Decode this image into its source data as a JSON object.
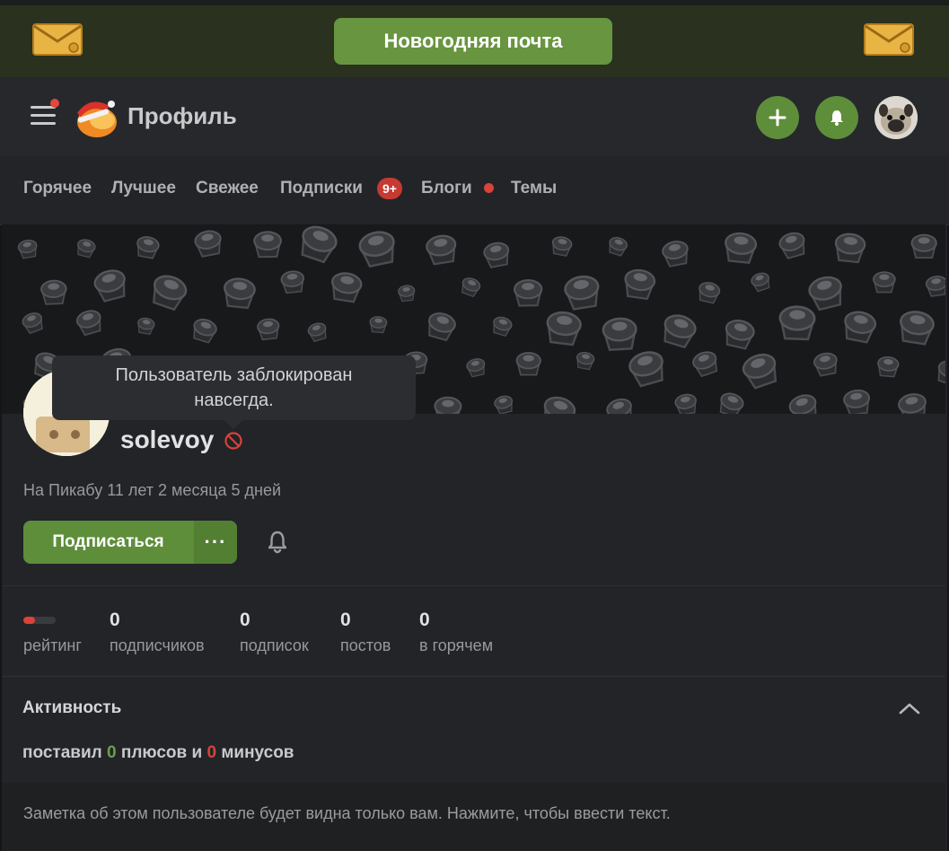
{
  "promo": {
    "label": "Новогодняя почта"
  },
  "header": {
    "title": "Профиль"
  },
  "tabs": [
    {
      "label": "Горячее"
    },
    {
      "label": "Лучшее"
    },
    {
      "label": "Свежее"
    },
    {
      "label": "Подписки"
    },
    {
      "label": "Блоги"
    },
    {
      "label": "Темы"
    }
  ],
  "subscriptions_badge": "9+",
  "profile": {
    "tooltip_line1": "Пользователь заблокирован",
    "tooltip_line2": "навсегда.",
    "username": "solevoy",
    "since": "На Пикабу 11 лет 2 месяца 5 дней",
    "subscribe_label": "Подписаться",
    "more_label": "···"
  },
  "stats": {
    "rating_label": "рейтинг",
    "items": [
      {
        "value": "0",
        "label": "подписчиков"
      },
      {
        "value": "0",
        "label": "подписок"
      },
      {
        "value": "0",
        "label": "постов"
      },
      {
        "value": "0",
        "label": "в горячем"
      }
    ]
  },
  "activity": {
    "title": "Активность",
    "prefix": "поставил",
    "plus_count": "0",
    "middle": "плюсов и",
    "minus_count": "0",
    "suffix": "минусов"
  },
  "note": {
    "placeholder": "Заметка об этом пользователе будет видна только вам. Нажмите, чтобы ввести текст."
  },
  "colors": {
    "accent": "#5e8e3a",
    "danger": "#d8433a",
    "background": "#232427"
  }
}
